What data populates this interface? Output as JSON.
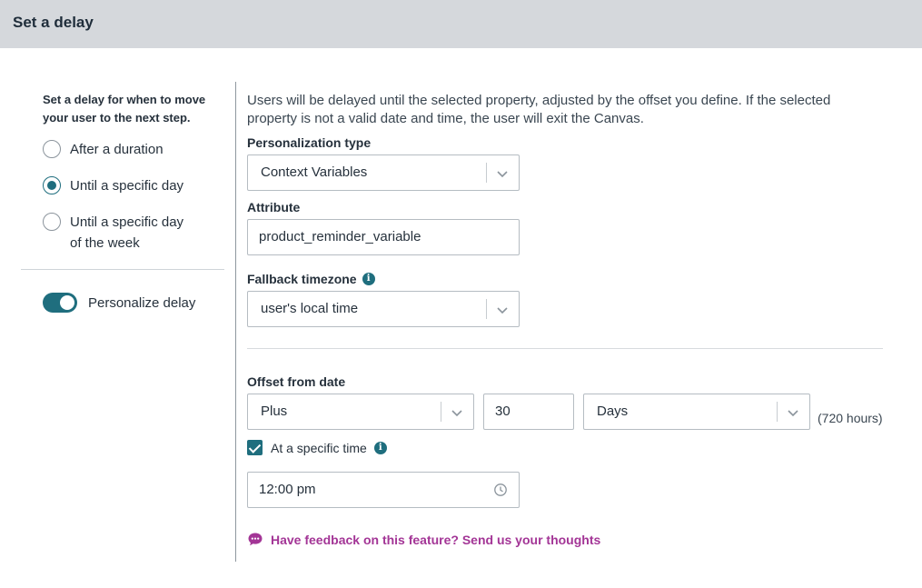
{
  "header": {
    "title": "Set a delay"
  },
  "left": {
    "heading": "Set a delay for when to move your user to the next step.",
    "options": [
      {
        "label": "After a duration",
        "checked": false
      },
      {
        "label": "Until a specific day",
        "checked": true
      },
      {
        "label": "Until a specific day of the week",
        "checked": false
      }
    ],
    "toggle": {
      "label": "Personalize delay",
      "on": true
    }
  },
  "right": {
    "description": "Users will be delayed until the selected property, adjusted by the offset you define. If the selected property is not a valid date and time, the user will exit the Canvas.",
    "personalization": {
      "label": "Personalization type",
      "value": "Context Variables"
    },
    "attribute": {
      "label": "Attribute",
      "value": "product_reminder_variable"
    },
    "fallback": {
      "label": "Fallback timezone",
      "value": "user's local time",
      "info_icon": "info-icon"
    },
    "offset": {
      "label": "Offset from date",
      "direction": "Plus",
      "amount": "30",
      "unit": "Days",
      "hours_note": "(720 hours)"
    },
    "specific_time": {
      "label": "At a specific time",
      "checked": true,
      "value": "12:00 pm"
    },
    "feedback": {
      "text": "Have feedback on this feature? Send us your thoughts",
      "color": "#a33596"
    }
  },
  "colors": {
    "accent": "#1f6e7e",
    "header_bg": "#d5d8dc"
  }
}
